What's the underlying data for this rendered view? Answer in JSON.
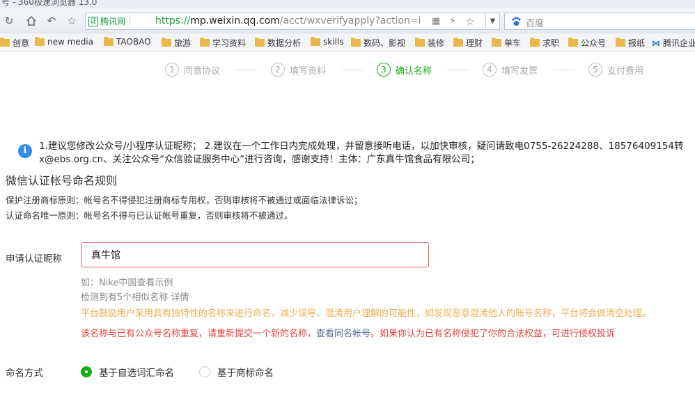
{
  "browser": {
    "title": "号 - 360极速浏览器 13.0",
    "url_scheme": "https://",
    "url_host": "mp.weixin.qq.com",
    "url_path": "/acct/wxverifyapply?action=inde",
    "secure_org": "腾讯网",
    "search_engine": "百度"
  },
  "bookmarks": [
    {
      "label": "创意",
      "icon": "folder-icon"
    },
    {
      "label": "new media",
      "icon": "folder-icon"
    },
    {
      "label": "TAOBAO",
      "icon": "folder-icon"
    },
    {
      "label": "旅游",
      "icon": "folder-icon"
    },
    {
      "label": "学习资料",
      "icon": "folder-icon"
    },
    {
      "label": "数据分析",
      "icon": "folder-icon"
    },
    {
      "label": "skills",
      "icon": "folder-icon"
    },
    {
      "label": "数码、影视",
      "icon": "folder-icon"
    },
    {
      "label": "装修",
      "icon": "folder-icon"
    },
    {
      "label": "理财",
      "icon": "folder-icon"
    },
    {
      "label": "单车",
      "icon": "folder-icon"
    },
    {
      "label": "求职",
      "icon": "folder-icon"
    },
    {
      "label": "公众号",
      "icon": "folder-icon"
    },
    {
      "label": "报纸",
      "icon": "folder-icon"
    },
    {
      "label": "腾讯企业",
      "icon": "tencent-exmail-icon"
    }
  ],
  "steps": [
    {
      "num": "1",
      "label": "同意协议",
      "active": false
    },
    {
      "num": "2",
      "label": "填写资料",
      "active": false
    },
    {
      "num": "3",
      "label": "确认名称",
      "active": true
    },
    {
      "num": "4",
      "label": "填写发票",
      "active": false
    },
    {
      "num": "5",
      "label": "支付费用",
      "active": false
    }
  ],
  "notice": {
    "line1": "1.建议您修改公众号/小程序认证昵称； 2.建议在一个工作日内完成处理，并留意接听电话，以加快审核，疑问请致电0755-26224288、18576409154转",
    "line2": "x@ebs.org.cn、关注公众号“众信验证服务中心”进行咨询，感谢支持！主体：广东真牛馆食品有限公司；"
  },
  "rules": {
    "title": "微信认证帐号命名规则",
    "line1": "保护注册商标原则：帐号名不得侵犯注册商标专用权，否则审核将不被通过或面临法律诉讼；",
    "line2": "认证命名唯一原则：帐号名不得与已认证帐号重复，否则审核将不被通过。"
  },
  "form": {
    "name_label": "申请认证昵称",
    "name_value": "真牛馆",
    "example_prefix": "如：Nike中国",
    "example_link": "查看示例",
    "similar_text": "检测到有5个相似名称",
    "similar_link": "详情",
    "platform_tip": "平台鼓励用户采用具有独特性的名称来进行命名，减少误导、混淆用户理解的可能性，如发现恶意混淆他人的账号名称，平台将会做清空处理。",
    "dup_error_pre": "该名称与已有公众号名称重复，请重新提交一个新的名称，",
    "dup_error_link": "查看同名帐号",
    "dup_error_post": "。如果你认为已有名称侵犯了你的合法权益，可进行侵权投诉",
    "naming_label": "命名方式",
    "option_custom": "基于自选词汇命名",
    "option_trademark": "基于商标命名",
    "selected_option": "custom"
  },
  "colors": {
    "accent_green": "#1aad19",
    "error_red": "#e64340",
    "warn_orange": "#f0ad4e",
    "info_blue": "#2d8ced",
    "link_blue": "#576b95"
  }
}
